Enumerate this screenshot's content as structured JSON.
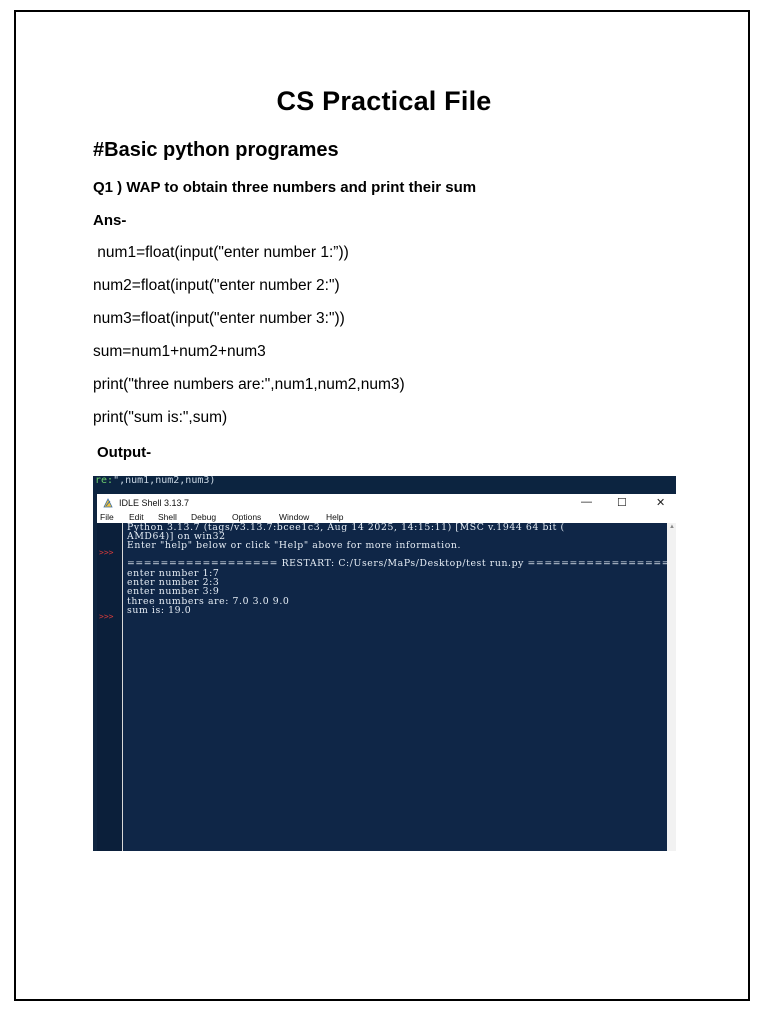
{
  "document": {
    "title": "CS Practical File",
    "heading": "#Basic python programes",
    "question": "Q1 ) WAP to obtain three numbers and print their sum",
    "ans_label": "Ans-",
    "code_lines": [
      " num1=float(input(\"enter number 1:”))",
      "num2=float(input(\"enter number 2:\")",
      "num3=float(input(\"enter number 3:\"))",
      "sum=num1+num2+num3",
      "print(\"three numbers are:\",num1,num2,num3)",
      "print(\"sum is:\",sum)"
    ],
    "output_label": "Output-"
  },
  "screenshot": {
    "top_strip_text_green": "re:",
    "top_strip_text": "\",num1,num2,num3)",
    "window_title": "IDLE Shell 3.13.7",
    "controls": {
      "minimize": "—",
      "maximize": "☐",
      "close": "✕"
    },
    "menu": [
      "File",
      "Edit",
      "Shell",
      "Debug",
      "Options",
      "Window",
      "Help"
    ],
    "prompt_symbol": ">>>",
    "shell_lines": [
      "Python 3.13.7 (tags/v3.13.7:bcee1c3, Aug 14 2025, 14:15:11) [MSC v.1944 64 bit (",
      "AMD64)] on win32",
      "Enter \"help\" below or click \"Help\" above for more information.",
      "",
      "================== RESTART: C:/Users/MaPs/Desktop/test run.py ==================",
      "enter number 1:7",
      "enter number 2:3",
      "enter number 3:9",
      "three numbers are: 7.0 3.0 9.0",
      "sum is: 19.0"
    ],
    "colors": {
      "shell_background": "#0f2647",
      "shell_text": "#e6edf5",
      "prompt": "#d23a3a"
    }
  }
}
